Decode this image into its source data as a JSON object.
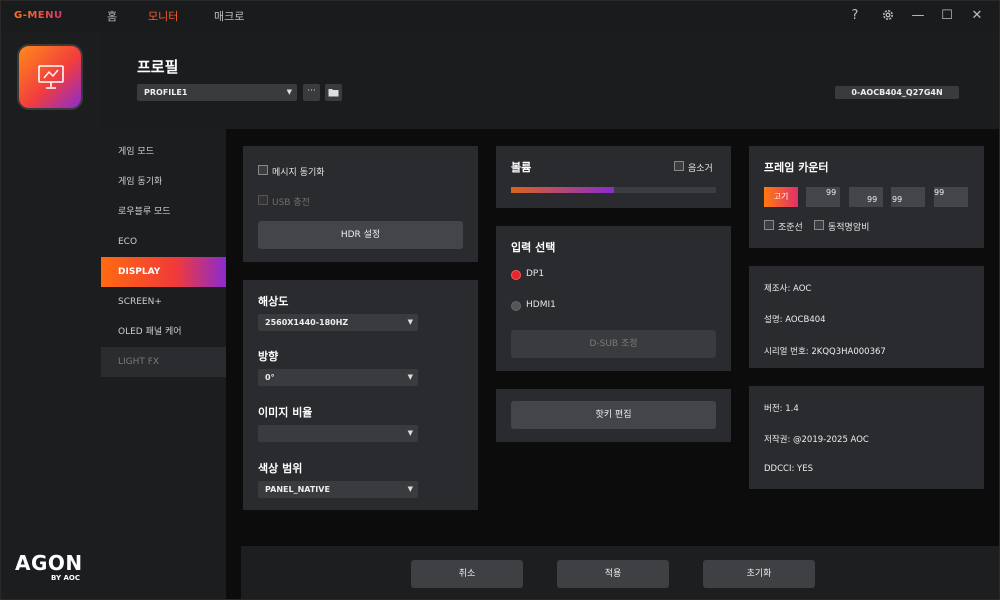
{
  "app": {
    "logo": "G-MENU"
  },
  "nav": {
    "home": "홈",
    "monitor": "모니터",
    "macro": "매크로"
  },
  "titlebar": {
    "help": "?",
    "minimize": "—",
    "maximize": "☐",
    "close": "✕"
  },
  "brand": {
    "agon": "AGON",
    "byaoc": "BY AOC"
  },
  "header": {
    "title": "프로필",
    "profile_value": "PROFILE1",
    "more_label": "···",
    "model": "0-AOCB404_Q27G4N"
  },
  "menu": {
    "items": [
      {
        "label": "게임 모드"
      },
      {
        "label": "게임 동기화"
      },
      {
        "label": "로우블루 모드"
      },
      {
        "label": "ECO"
      },
      {
        "label": "DISPLAY"
      },
      {
        "label": "SCREEN+"
      },
      {
        "label": "OLED 패널 케어"
      },
      {
        "label": "LIGHT FX"
      }
    ],
    "active_index": 4
  },
  "sync_panel": {
    "message_sync": "메시지 동기화",
    "usb_charge": "USB 충전",
    "hdr_button": "HDR 설정"
  },
  "display_panel": {
    "resolution_label": "해상도",
    "resolution_value": "2560X1440-180HZ",
    "direction_label": "방향",
    "direction_value": "0°",
    "aspect_label": "이미지 비율",
    "aspect_value": "",
    "color_label": "색상 범위",
    "color_value": "PANEL_NATIVE"
  },
  "volume_panel": {
    "title": "볼륨",
    "mute_label": "음소거",
    "level": 0.5
  },
  "input_panel": {
    "title": "입력 선택",
    "options": [
      "DP1",
      "HDMI1"
    ],
    "selected": "DP1",
    "dsub_button": "D-SUB 조정"
  },
  "hotkey_panel": {
    "button": "핫키 편집"
  },
  "frame_panel": {
    "title": "프레임 카운터",
    "fixed_label": "고기",
    "values": [
      "99",
      "99",
      "99",
      "99"
    ],
    "crosshair": "조준선",
    "dynamic_dark": "동적명암비"
  },
  "info_panel": {
    "manufacturer": "제조사: AOC",
    "description": "설명: AOCB404",
    "serial": "시리얼 번호: 2KQQ3HA000367"
  },
  "version_panel": {
    "version": "버전: 1.4",
    "copyright": "저작권: @2019-2025 AOC",
    "ddcci": "DDCCI: YES"
  },
  "footer": {
    "cancel": "취소",
    "apply": "적용",
    "reset": "초기화"
  },
  "colors": {
    "accent": "#ff5a28",
    "radio_on": "#e8242c",
    "panel": "#2a2b2e"
  }
}
